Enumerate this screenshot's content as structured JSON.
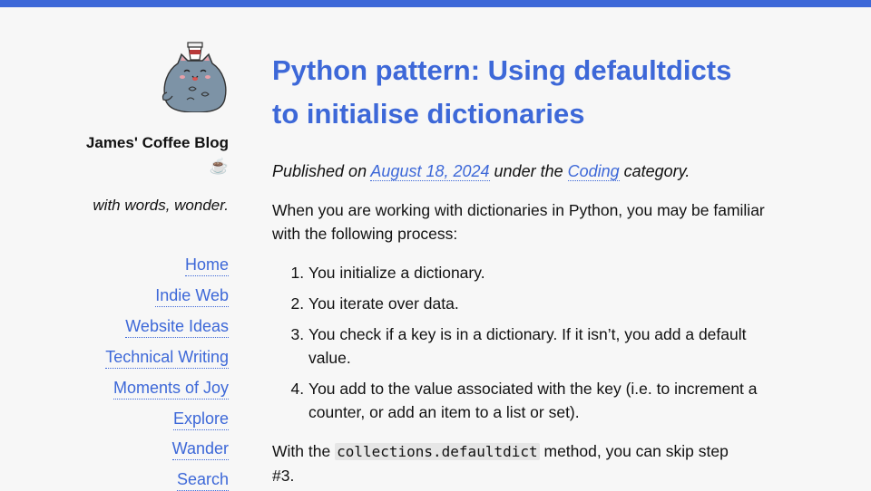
{
  "site": {
    "title": "James' Coffee Blog ☕",
    "tagline": "with words, wonder."
  },
  "nav": [
    {
      "label": "Home"
    },
    {
      "label": "Indie Web"
    },
    {
      "label": "Website Ideas"
    },
    {
      "label": "Technical Writing"
    },
    {
      "label": "Moments of Joy"
    },
    {
      "label": "Explore"
    },
    {
      "label": "Wander"
    },
    {
      "label": "Search"
    }
  ],
  "post": {
    "title": "Python pattern: Using defaultdicts to initialise dictionaries",
    "meta_published": "Published on ",
    "meta_date": "August 18, 2024",
    "meta_under": " under the ",
    "meta_category": "Coding",
    "meta_suffix": " category.",
    "intro": "When you are working with dictionaries in Python, you may be familiar with the following process:",
    "steps": [
      "You initialize a dictionary.",
      "You iterate over data.",
      "You check if a key is in a dictionary. If it isn’t, you add a default value.",
      "You add to the value associated with the key (i.e. to increment a counter, or add an item to a list or set)."
    ],
    "p2_before": "With the ",
    "p2_code": "collections.defaultdict",
    "p2_after": " method, you can skip step #3."
  },
  "colors": {
    "accent": "#3d68d8",
    "background": "#f7f7f7"
  },
  "icons": {
    "avatar": "coffee-cat-avatar-icon"
  }
}
